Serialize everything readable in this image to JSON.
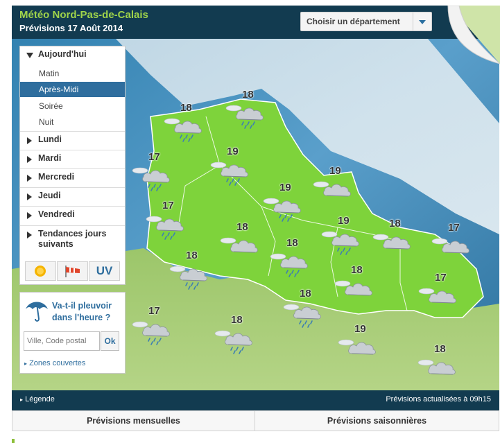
{
  "header": {
    "title": "Météo Nord-Pas-de-Calais",
    "subtitle": "Prévisions 17 Août 2014",
    "dept_select": "Choisir un département"
  },
  "sidebar": {
    "today": "Aujourd'hui",
    "periods": [
      "Matin",
      "Après-Midi",
      "Soirée",
      "Nuit"
    ],
    "active_period": "Après-Midi",
    "days": [
      "Lundi",
      "Mardi",
      "Mercredi",
      "Jeudi",
      "Vendredi"
    ],
    "trends_line1": "Tendances jours",
    "trends_line2": "suivants",
    "uv": "UV"
  },
  "rain_box": {
    "line1": "Va-t-il pleuvoir",
    "line2": "dans l'heure ?",
    "placeholder": "Ville, Code postal",
    "ok": "Ok",
    "zones": "Zones couvertes"
  },
  "footer": {
    "legend": "Légende",
    "updated": "Prévisions actualisées à 09h15"
  },
  "tabs": {
    "monthly": "Prévisions mensuelles",
    "seasonal": "Prévisions saisonnières"
  },
  "forecast": [
    {
      "temp": "18",
      "sky": "cloudy-rain"
    },
    {
      "temp": "18",
      "sky": "cloudy-rain"
    },
    {
      "temp": "17",
      "sky": "cloudy-rain"
    },
    {
      "temp": "19",
      "sky": "cloudy-rain"
    },
    {
      "temp": "19",
      "sky": "cloudy-rain"
    },
    {
      "temp": "19",
      "sky": "cloudy"
    },
    {
      "temp": "17",
      "sky": "cloudy-rain"
    },
    {
      "temp": "18",
      "sky": "cloudy"
    },
    {
      "temp": "19",
      "sky": "cloudy-rain"
    },
    {
      "temp": "18",
      "sky": "cloudy"
    },
    {
      "temp": "17",
      "sky": "cloudy"
    },
    {
      "temp": "18",
      "sky": "cloudy-rain"
    },
    {
      "temp": "18",
      "sky": "cloudy-rain"
    },
    {
      "temp": "18",
      "sky": "cloudy"
    },
    {
      "temp": "17",
      "sky": "cloudy"
    },
    {
      "temp": "18",
      "sky": "cloudy-rain"
    },
    {
      "temp": "17",
      "sky": "cloudy-rain"
    },
    {
      "temp": "18",
      "sky": "cloudy-rain"
    },
    {
      "temp": "19",
      "sky": "cloudy"
    },
    {
      "temp": "18",
      "sky": "cloudy"
    }
  ]
}
